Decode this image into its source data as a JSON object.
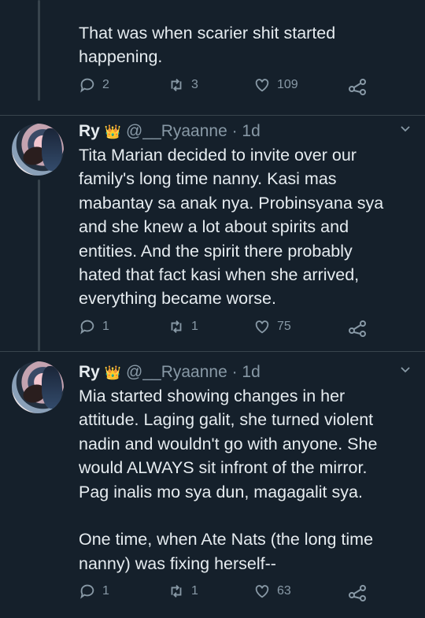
{
  "tweets": [
    {
      "text": "That was when scarier shit started\nhappening.",
      "replies": "2",
      "retweets": "3",
      "likes": "109"
    },
    {
      "name": "Ry",
      "crown": "👑",
      "handle": "@__Ryaanne · 1d",
      "text": "Tita Marian decided to invite over our\nfamily's long time nanny. Kasi mas\nmabantay sa anak nya. Probinsyana sya\nand she knew a lot about spirits and\nentities. And the spirit there probably\nhated that fact kasi when she arrived,\neverything became worse.",
      "replies": "1",
      "retweets": "1",
      "likes": "75"
    },
    {
      "name": "Ry",
      "crown": "👑",
      "handle": "@__Ryaanne · 1d",
      "text": "Mia started showing changes in her\nattitude. Laging galit, she turned violent\nnadin and wouldn't go with anyone. She\nwould ALWAYS sit infront of the mirror.\nPag inalis mo sya dun, magagalit sya.\n\nOne time, when Ate Nats (the long time\nnanny) was fixing herself--",
      "replies": "1",
      "retweets": "1",
      "likes": "63"
    }
  ],
  "icons": {
    "reply": "reply-icon",
    "retweet": "retweet-icon",
    "like": "heart-icon",
    "share": "share-icon",
    "more": "chevron-down-icon"
  },
  "colors": {
    "background": "#15202b",
    "text": "#e6ecf0",
    "muted": "#8899a6",
    "divider": "#38444d"
  }
}
